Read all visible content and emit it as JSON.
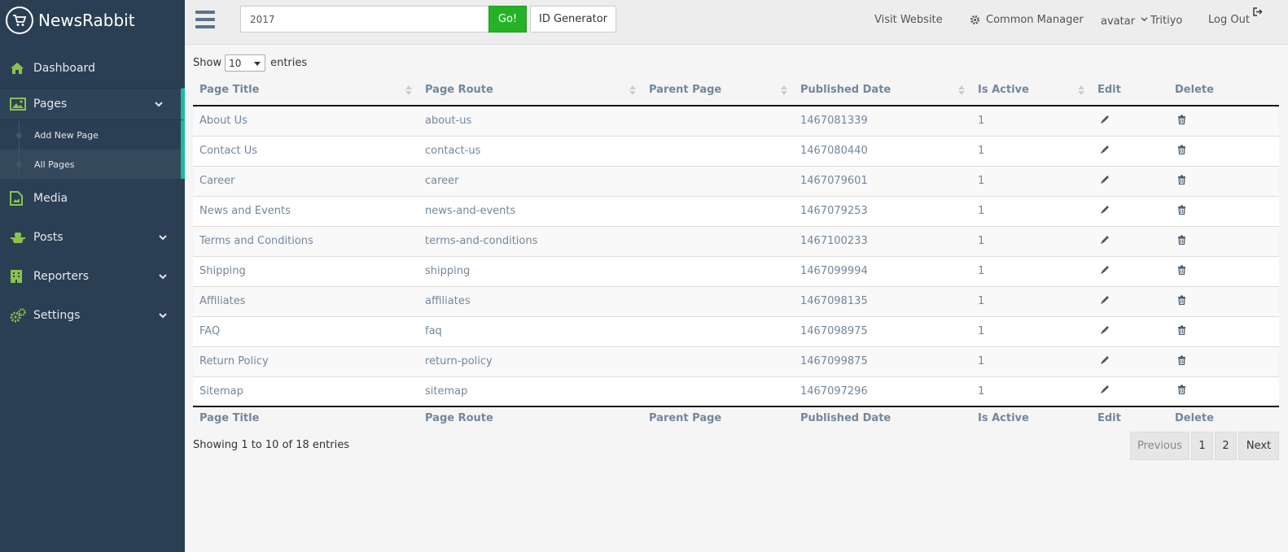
{
  "brand": {
    "name": "NewsRabbit",
    "icon": "cart-icon"
  },
  "sidebar": {
    "items": [
      {
        "label": "Dashboard",
        "icon": "home-icon"
      },
      {
        "label": "Pages",
        "icon": "image-icon"
      },
      {
        "label": "Media",
        "icon": "media-file-icon"
      },
      {
        "label": "Posts",
        "icon": "posts-icon"
      },
      {
        "label": "Reporters",
        "icon": "building-icon"
      },
      {
        "label": "Settings",
        "icon": "gears-icon"
      }
    ],
    "pages_submenu": [
      {
        "label": "Add New Page"
      },
      {
        "label": "All Pages"
      }
    ]
  },
  "topbar": {
    "search_value": "2017",
    "go_label": "Go!",
    "id_generator_label": "ID Generator",
    "visit_website": "Visit Website",
    "common_manager": "Common Manager",
    "avatar_alt": "avatar",
    "user_name": "Tritiyo",
    "logout": "Log Out"
  },
  "table": {
    "show_label": "Show",
    "entries_label": "entries",
    "page_length": "10",
    "columns": [
      "Page Title",
      "Page Route",
      "Parent Page",
      "Published Date",
      "Is Active",
      "Edit",
      "Delete"
    ],
    "rows": [
      {
        "title": "About Us",
        "route": "about-us",
        "parent": "",
        "published": "1467081339",
        "active": "1"
      },
      {
        "title": "Contact Us",
        "route": "contact-us",
        "parent": "",
        "published": "1467080440",
        "active": "1"
      },
      {
        "title": "Career",
        "route": "career",
        "parent": "",
        "published": "1467079601",
        "active": "1"
      },
      {
        "title": "News and Events",
        "route": "news-and-events",
        "parent": "",
        "published": "1467079253",
        "active": "1"
      },
      {
        "title": "Terms and Conditions",
        "route": "terms-and-conditions",
        "parent": "",
        "published": "1467100233",
        "active": "1"
      },
      {
        "title": "Shipping",
        "route": "shipping",
        "parent": "",
        "published": "1467099994",
        "active": "1"
      },
      {
        "title": "Affiliates",
        "route": "affiliates",
        "parent": "",
        "published": "1467098135",
        "active": "1"
      },
      {
        "title": "FAQ",
        "route": "faq",
        "parent": "",
        "published": "1467098975",
        "active": "1"
      },
      {
        "title": "Return Policy",
        "route": "return-policy",
        "parent": "",
        "published": "1467099875",
        "active": "1"
      },
      {
        "title": "Sitemap",
        "route": "sitemap",
        "parent": "",
        "published": "1467097296",
        "active": "1"
      }
    ],
    "info": "Showing 1 to 10 of 18 entries",
    "pagination": {
      "previous": "Previous",
      "pages": [
        "1",
        "2"
      ],
      "next": "Next"
    }
  },
  "colors": {
    "sidebar_bg": "#2a3f54",
    "accent": "#1abb9c",
    "icon_green": "#8bc34a",
    "go_green": "#26b226",
    "link_text": "#73879c"
  }
}
